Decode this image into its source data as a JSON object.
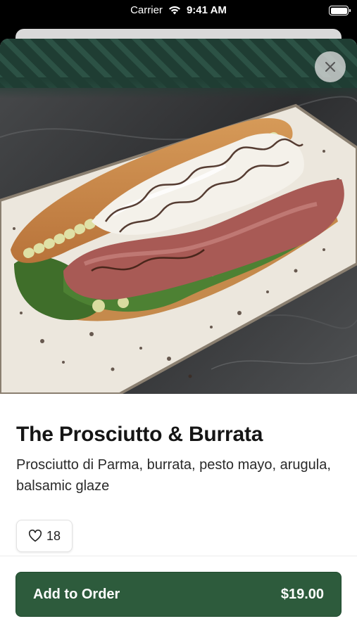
{
  "status_bar": {
    "carrier": "Carrier",
    "time": "9:41 AM"
  },
  "product": {
    "name": "The Prosciutto & Burrata",
    "description": "Prosciutto di Parma, burrata, pesto mayo, arugula, balsamic glaze",
    "like_count": "18"
  },
  "footer": {
    "add_label": "Add to Order",
    "price": "$19.00"
  },
  "colors": {
    "primary_green": "#2d5b3c",
    "hero_stripe": "#22453a"
  },
  "icons": {
    "close": "close-icon",
    "like": "heart-icon"
  }
}
